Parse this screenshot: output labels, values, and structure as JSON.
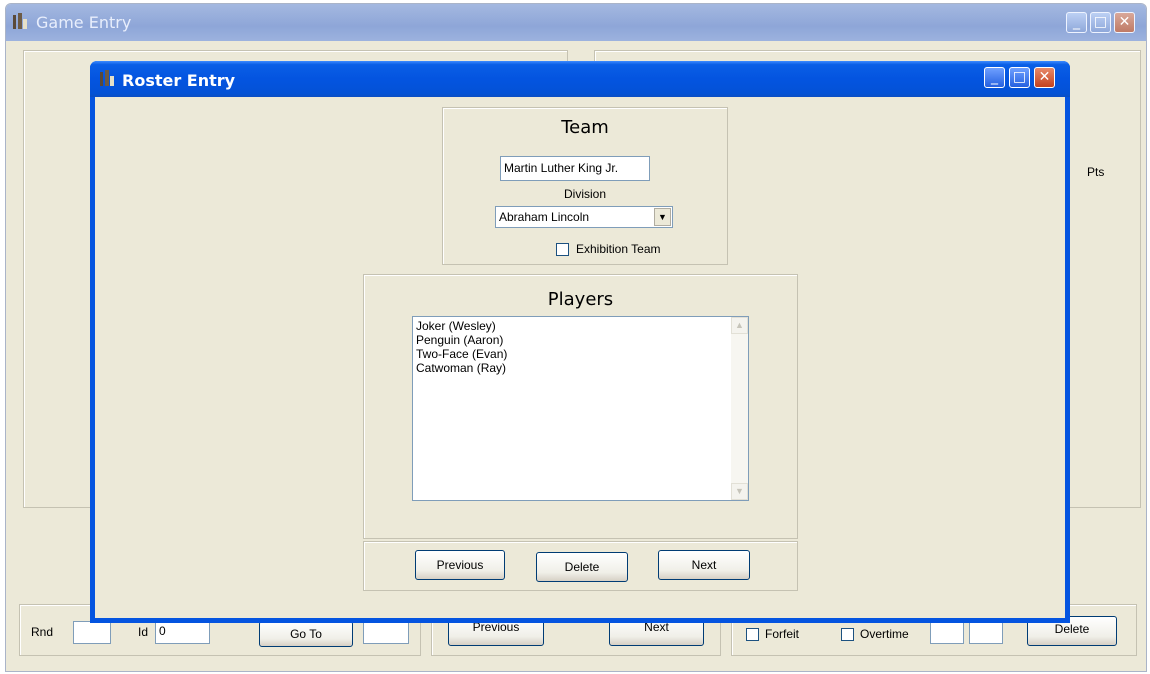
{
  "game_window": {
    "title": "Game Entry",
    "pts_label": "Pts",
    "footer": {
      "rnd_label": "Rnd",
      "rnd_value": "",
      "id_label": "Id",
      "id_value": "0",
      "goto_label": "Go To",
      "goto_value": "",
      "previous_label": "Previous",
      "next_label": "Next",
      "forfeit_label": "Forfeit",
      "overtime_label": "Overtime",
      "score1_value": "",
      "score2_value": "",
      "delete_label": "Delete"
    }
  },
  "roster_window": {
    "title": "Roster Entry",
    "team": {
      "heading": "Team",
      "name_value": "Martin Luther King Jr.",
      "division_label": "Division",
      "division_value": "Abraham Lincoln",
      "exhibition_label": "Exhibition Team",
      "exhibition_checked": false
    },
    "players": {
      "heading": "Players",
      "items": [
        "Joker (Wesley)",
        "Penguin (Aaron)",
        "Two-Face (Evan)",
        "Catwoman (Ray)"
      ]
    },
    "buttons": {
      "previous_label": "Previous",
      "delete_label": "Delete",
      "next_label": "Next"
    }
  },
  "icons": {
    "app_icon": "app-icon",
    "minimize": "minimize-icon",
    "maximize": "maximize-icon",
    "close": "close-icon"
  },
  "colors": {
    "active_titlebar": "#0454e0",
    "inactive_titlebar": "#9cb2de",
    "window_bg": "#ece9d8",
    "close_red": "#c3411e"
  }
}
